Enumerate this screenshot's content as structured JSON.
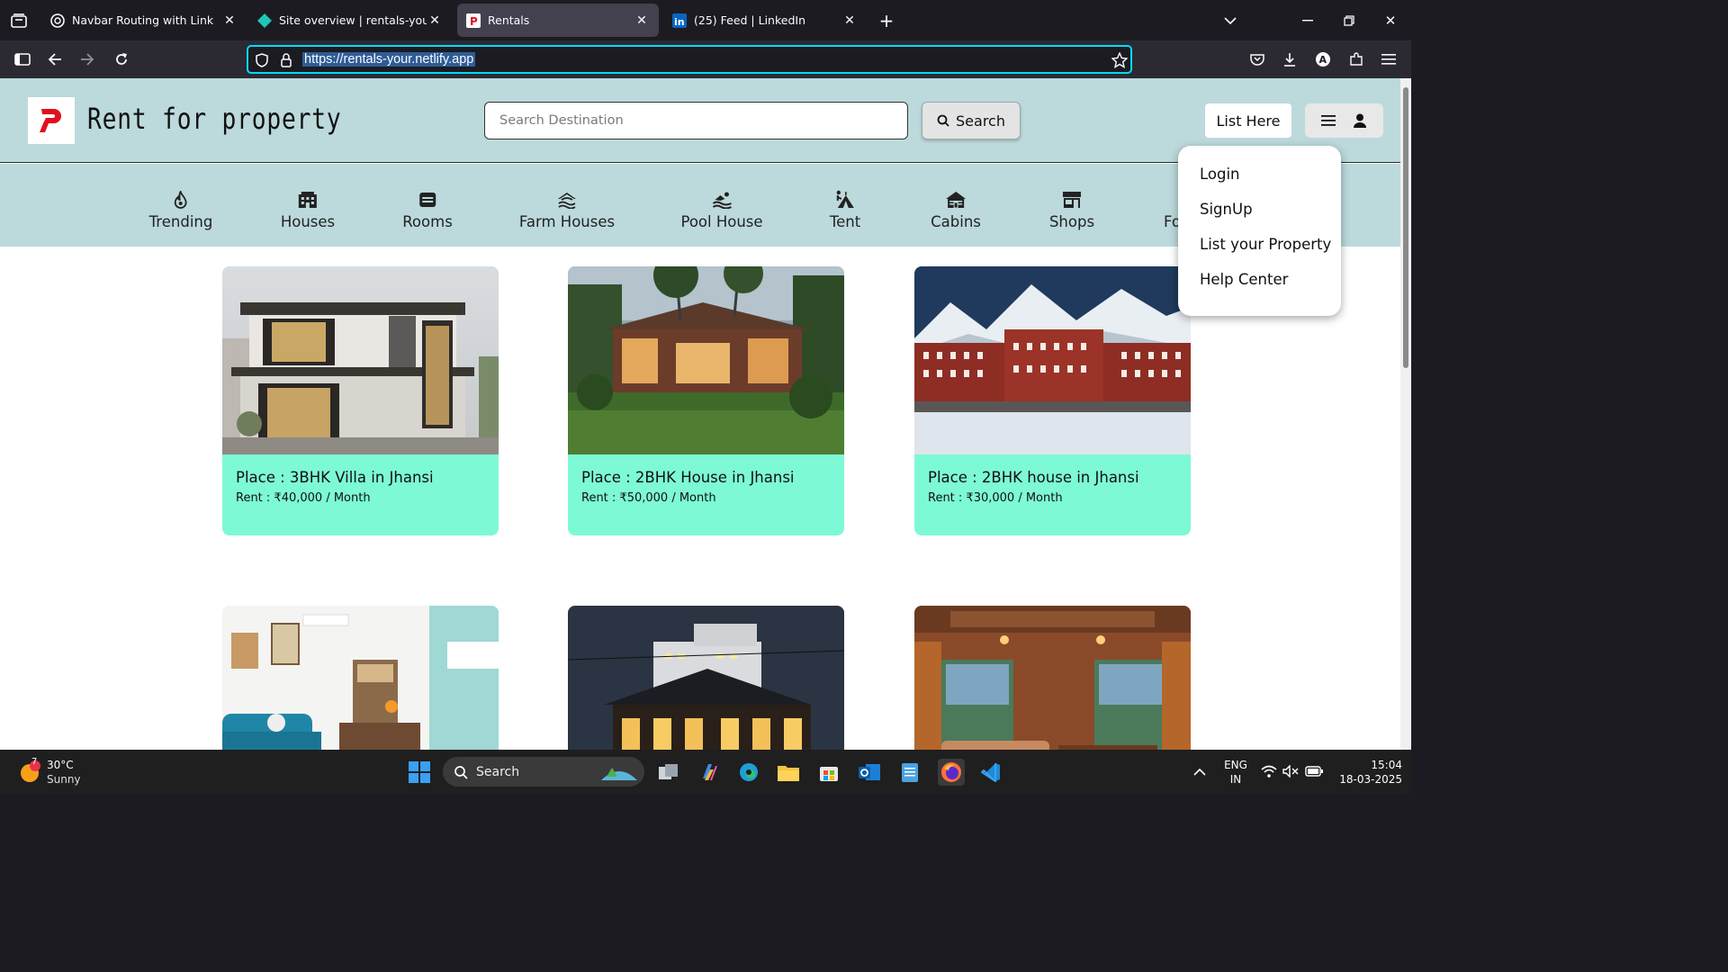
{
  "browser": {
    "tabs": [
      {
        "title": "Navbar Routing with Link",
        "active": false
      },
      {
        "title": "Site overview | rentals-your | Ne",
        "active": false
      },
      {
        "title": "Rentals",
        "active": true
      },
      {
        "title": "(25) Feed | LinkedIn",
        "active": false
      }
    ],
    "url": "https://rentals-your.netlify.app"
  },
  "site": {
    "logo_letter": "P",
    "brand": "Rent for property",
    "search_placeholder": "Search Destination",
    "search_button": "Search",
    "list_here": "List Here"
  },
  "categories": [
    {
      "label": "Trending",
      "icon": "fire-icon"
    },
    {
      "label": "Houses",
      "icon": "building-icon"
    },
    {
      "label": "Rooms",
      "icon": "bed-icon"
    },
    {
      "label": "Farm Houses",
      "icon": "farm-icon"
    },
    {
      "label": "Pool House",
      "icon": "swimmer-icon"
    },
    {
      "label": "Tent",
      "icon": "tent-icon"
    },
    {
      "label": "Cabins",
      "icon": "cabin-icon"
    },
    {
      "label": "Shops",
      "icon": "shop-icon"
    },
    {
      "label": "Fo",
      "icon": "forest-icon"
    }
  ],
  "dropdown": {
    "items": [
      "Login",
      "SignUp",
      "List your Property",
      "Help Center"
    ]
  },
  "listings": [
    {
      "place": "Place : 3BHK Villa in Jhansi",
      "rent": "Rent : ₹40,000 / Month"
    },
    {
      "place": "Place : 2BHK House in Jhansi",
      "rent": "Rent : ₹50,000 / Month"
    },
    {
      "place": "Place : 2BHK house in Jhansi",
      "rent": "Rent : ₹30,000 / Month"
    },
    {
      "place": "",
      "rent": ""
    },
    {
      "place": "",
      "rent": ""
    },
    {
      "place": "",
      "rent": ""
    }
  ],
  "taskbar": {
    "weather_temp": "30°C",
    "weather_desc": "Sunny",
    "weather_badge": "7",
    "search_label": "Search",
    "lang_line1": "ENG",
    "lang_line2": "IN",
    "time": "15:04",
    "date": "18-03-2025"
  },
  "colors": {
    "header_bg": "#bcd9dc",
    "card_bg": "#7df9d6",
    "logo_red": "#e0111f",
    "url_focus": "#00ddff"
  }
}
